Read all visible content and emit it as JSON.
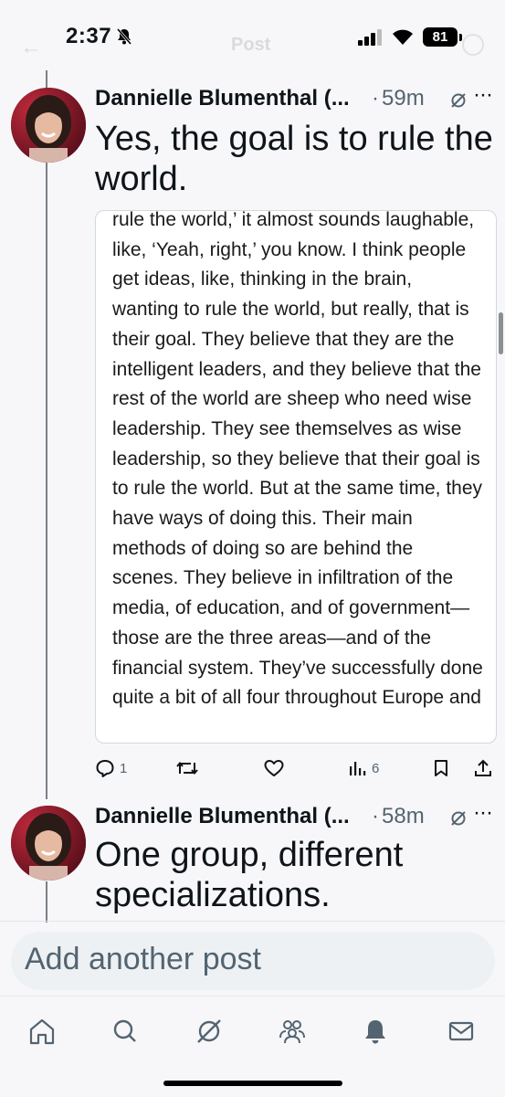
{
  "status": {
    "time": "2:37",
    "battery": "81"
  },
  "header": {
    "title": "Post"
  },
  "posts": [
    {
      "author": "Dannielle Blumenthal (...",
      "age": "59m",
      "text": "Yes, the goal is to rule the world.",
      "embed_text": "rule the world,’ it almost sounds laughable, like, ‘Yeah, right,’ you know. I think people get ideas, like, thinking in the brain, wanting to rule the world, but really, that is their goal. They believe that they are the intelligent leaders, and they believe that the rest of the world are sheep who need wise leadership. They see themselves as wise leadership, so they believe that their goal is to rule the world. But at the same time, they have ways of doing this. Their main methods of doing so are behind the scenes. They believe in infiltration of the media, of education, and of government—those are the three areas—and of the financial system. They’ve successfully done quite a bit of all four throughout Europe and",
      "replies": "1",
      "views": "6"
    },
    {
      "author": "Dannielle Blumenthal (...",
      "age": "58m",
      "text": "One group, different specializations."
    }
  ],
  "compose": {
    "placeholder": "Add another post"
  },
  "nav": [
    "home-icon",
    "search-icon",
    "grok-icon",
    "communities-icon",
    "notifications-icon",
    "messages-icon"
  ]
}
